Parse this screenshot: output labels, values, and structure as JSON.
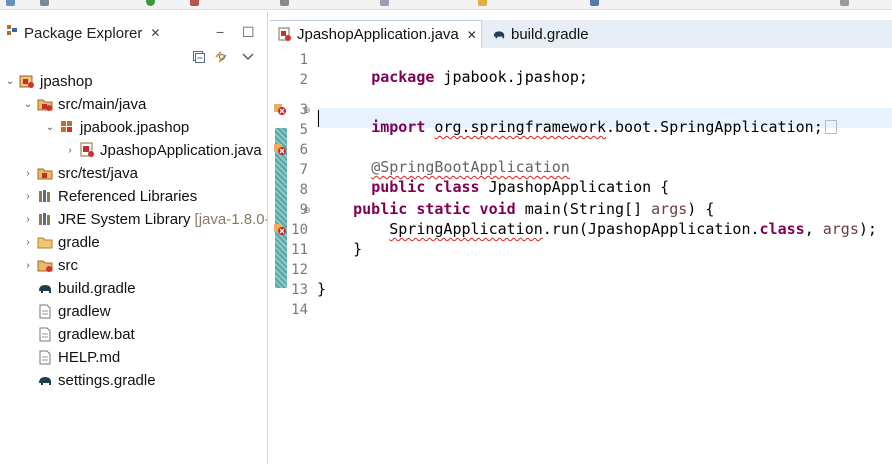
{
  "panel": {
    "tab_label": "Package Explorer",
    "close_glyph": "✕",
    "minimize_glyph": "−",
    "maximize_glyph": "☐"
  },
  "tree": [
    {
      "label": "jpashop",
      "icon": "gradle-project-icon",
      "twisty": "⌄"
    },
    {
      "label": "src/main/java",
      "icon": "source-folder-icon",
      "twisty": "⌄"
    },
    {
      "label": "jpabook.jpashop",
      "icon": "package-icon",
      "twisty": "⌄"
    },
    {
      "label": "JpashopApplication.java",
      "icon": "java-file-error-icon",
      "twisty": "›"
    },
    {
      "label": "src/test/java",
      "icon": "source-folder-icon",
      "twisty": "›"
    },
    {
      "label": "Referenced Libraries",
      "icon": "library-icon",
      "twisty": "›"
    },
    {
      "label": "JRE System Library",
      "suffix": "[java-1.8.0-",
      "icon": "library-icon",
      "twisty": "›"
    },
    {
      "label": "gradle",
      "icon": "folder-icon",
      "twisty": "›"
    },
    {
      "label": "src",
      "icon": "source-folder-icon",
      "twisty": "›"
    },
    {
      "label": "build.gradle",
      "icon": "gradle-elephant-icon",
      "twisty": ""
    },
    {
      "label": "gradlew",
      "icon": "file-icon",
      "twisty": ""
    },
    {
      "label": "gradlew.bat",
      "icon": "file-icon",
      "twisty": ""
    },
    {
      "label": "HELP.md",
      "icon": "file-icon",
      "twisty": ""
    },
    {
      "label": "settings.gradle",
      "icon": "gradle-elephant-icon",
      "twisty": ""
    }
  ],
  "editor": {
    "tabs": [
      {
        "label": "JpashopApplication.java",
        "active": true,
        "closable": true
      },
      {
        "label": "build.gradle",
        "active": false,
        "closable": false
      }
    ],
    "line_numbers": [
      "1",
      "2",
      "3",
      "5",
      "6",
      "7",
      "8",
      "9",
      "10",
      "11",
      "12",
      "13",
      "14"
    ],
    "code": {
      "l1_kw": "package",
      "l1_rest": " jpabook.jpashop;",
      "l3_kw": "import",
      "l3_pkg": "org.springframework",
      "l3_rest": ".boot.SpringApplication;",
      "l6_ann": "@SpringBootApplication",
      "l7_kw": "public class",
      "l7_rest": " JpashopApplication {",
      "l9_kw1": "public static void",
      "l9_rest1": " main(String[] ",
      "l9_param": "args",
      "l9_rest2": ") {",
      "l10_type": "SpringApplication",
      "l10_rest1": ".run(JpashopApplication.",
      "l10_kw": "class",
      "l10_rest2": ", ",
      "l10_param": "args",
      "l10_rest3": ");",
      "l11": "}",
      "l13": "}"
    }
  },
  "colors": {
    "keyword": "#7f0055",
    "annotation": "#646464",
    "change_bar": "#5aa6a6",
    "current_line": "#e8f2fe"
  }
}
